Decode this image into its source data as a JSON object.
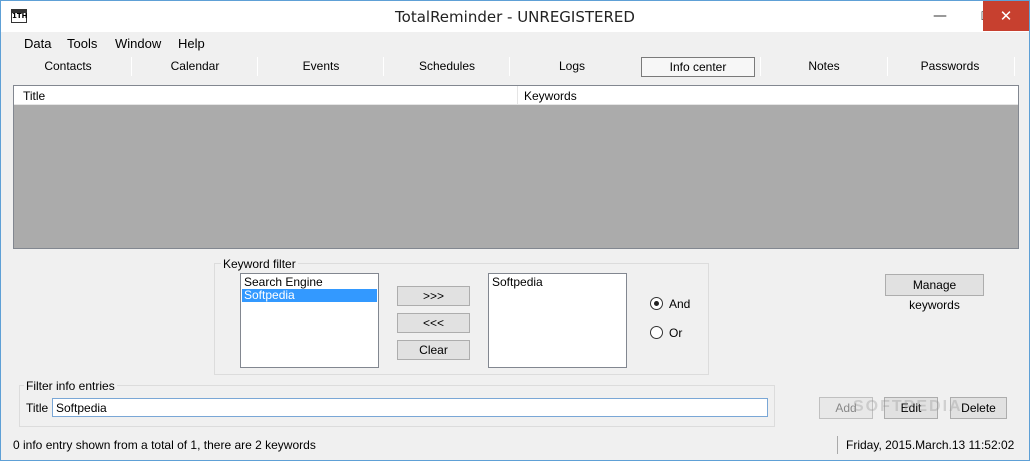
{
  "window": {
    "title": "TotalReminder - UNREGISTERED",
    "icon_text": "1TH",
    "minimize_glyph": "—",
    "maximize_glyph": "☐",
    "close_glyph": "✕"
  },
  "menu": [
    "Data",
    "Tools",
    "Window",
    "Help"
  ],
  "tabs": [
    {
      "label": "Contacts",
      "active": false
    },
    {
      "label": "Calendar",
      "active": false
    },
    {
      "label": "Events",
      "active": false
    },
    {
      "label": "Schedules",
      "active": false
    },
    {
      "label": "Logs",
      "active": false
    },
    {
      "label": "Info center",
      "active": true
    },
    {
      "label": "Notes",
      "active": false
    },
    {
      "label": "Passwords",
      "active": false
    }
  ],
  "grid": {
    "columns": [
      "Title",
      "Keywords"
    ]
  },
  "keyword_filter": {
    "label": "Keyword filter",
    "available": [
      {
        "text": "Search Engine",
        "selected": false
      },
      {
        "text": "Softpedia",
        "selected": true
      }
    ],
    "add_label": ">>>",
    "remove_label": "<<<",
    "clear_label": "Clear",
    "chosen": [
      "Softpedia"
    ],
    "mode_and": "And",
    "mode_or": "Or",
    "mode_selected": "And"
  },
  "manage_keywords_label": "Manage keywords",
  "filter_entries": {
    "label": "Filter info entries",
    "title_label": "Title",
    "title_value": "Softpedia"
  },
  "actions": {
    "add": "Add",
    "edit": "Edit",
    "delete": "Delete"
  },
  "status": {
    "left": "0 info entry shown from a total of 1, there are 2 keywords",
    "right": "Friday, 2015.March.13 11:52:02"
  },
  "watermark": "SOFTPEDIA"
}
